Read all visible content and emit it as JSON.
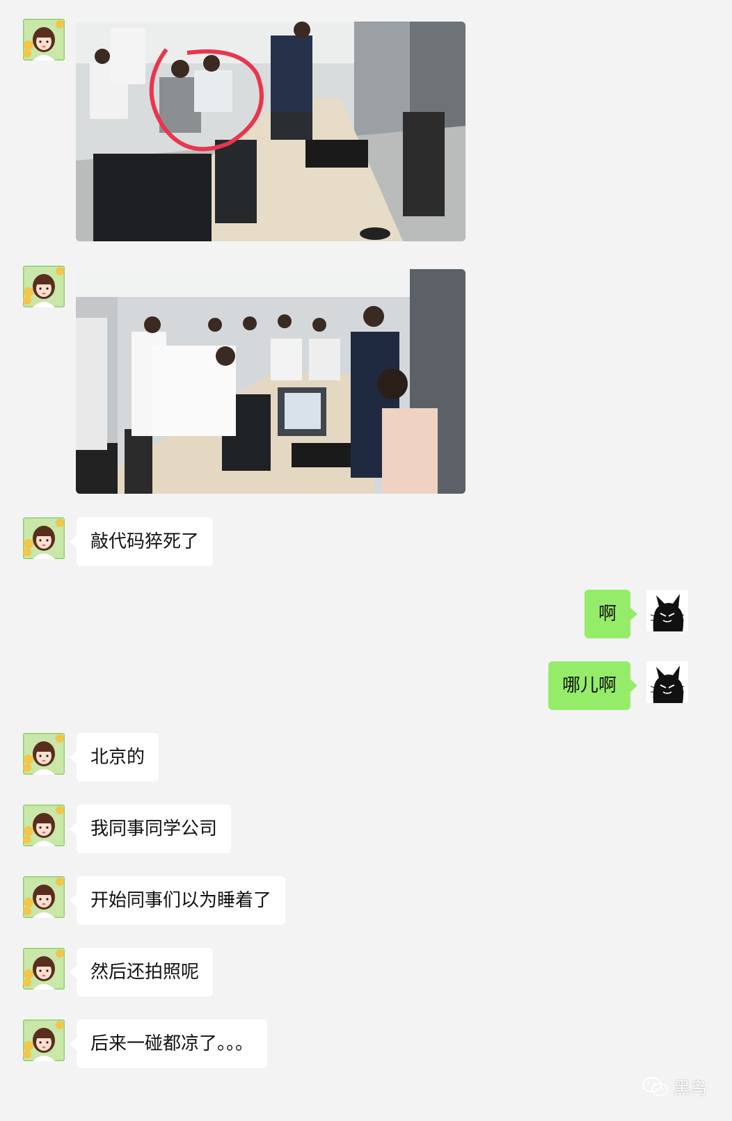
{
  "colors": {
    "background": "#f3f3f3",
    "incoming_bubble": "#ffffff",
    "outgoing_bubble": "#95ec69",
    "circle_annotation": "#e8364f"
  },
  "icons": {
    "sender_avatar": "cartoon-girl-avatar-icon",
    "self_avatar": "black-cat-avatar-icon",
    "watermark": "wechat-icon"
  },
  "messages": [
    {
      "side": "left",
      "type": "image",
      "image_name": "office-photo-1"
    },
    {
      "side": "left",
      "type": "image",
      "image_name": "office-photo-2"
    },
    {
      "side": "left",
      "type": "text",
      "text": "敲代码猝死了"
    },
    {
      "side": "right",
      "type": "text",
      "text": "啊"
    },
    {
      "side": "right",
      "type": "text",
      "text": "哪儿啊"
    },
    {
      "side": "left",
      "type": "text",
      "text": "北京的"
    },
    {
      "side": "left",
      "type": "text",
      "text": "我同事同学公司"
    },
    {
      "side": "left",
      "type": "text",
      "text": "开始同事们以为睡着了"
    },
    {
      "side": "left",
      "type": "text",
      "text": "然后还拍照呢"
    },
    {
      "side": "left",
      "type": "text",
      "text": "后来一碰都凉了。。。"
    }
  ],
  "watermark": {
    "text": "黑鸟"
  }
}
